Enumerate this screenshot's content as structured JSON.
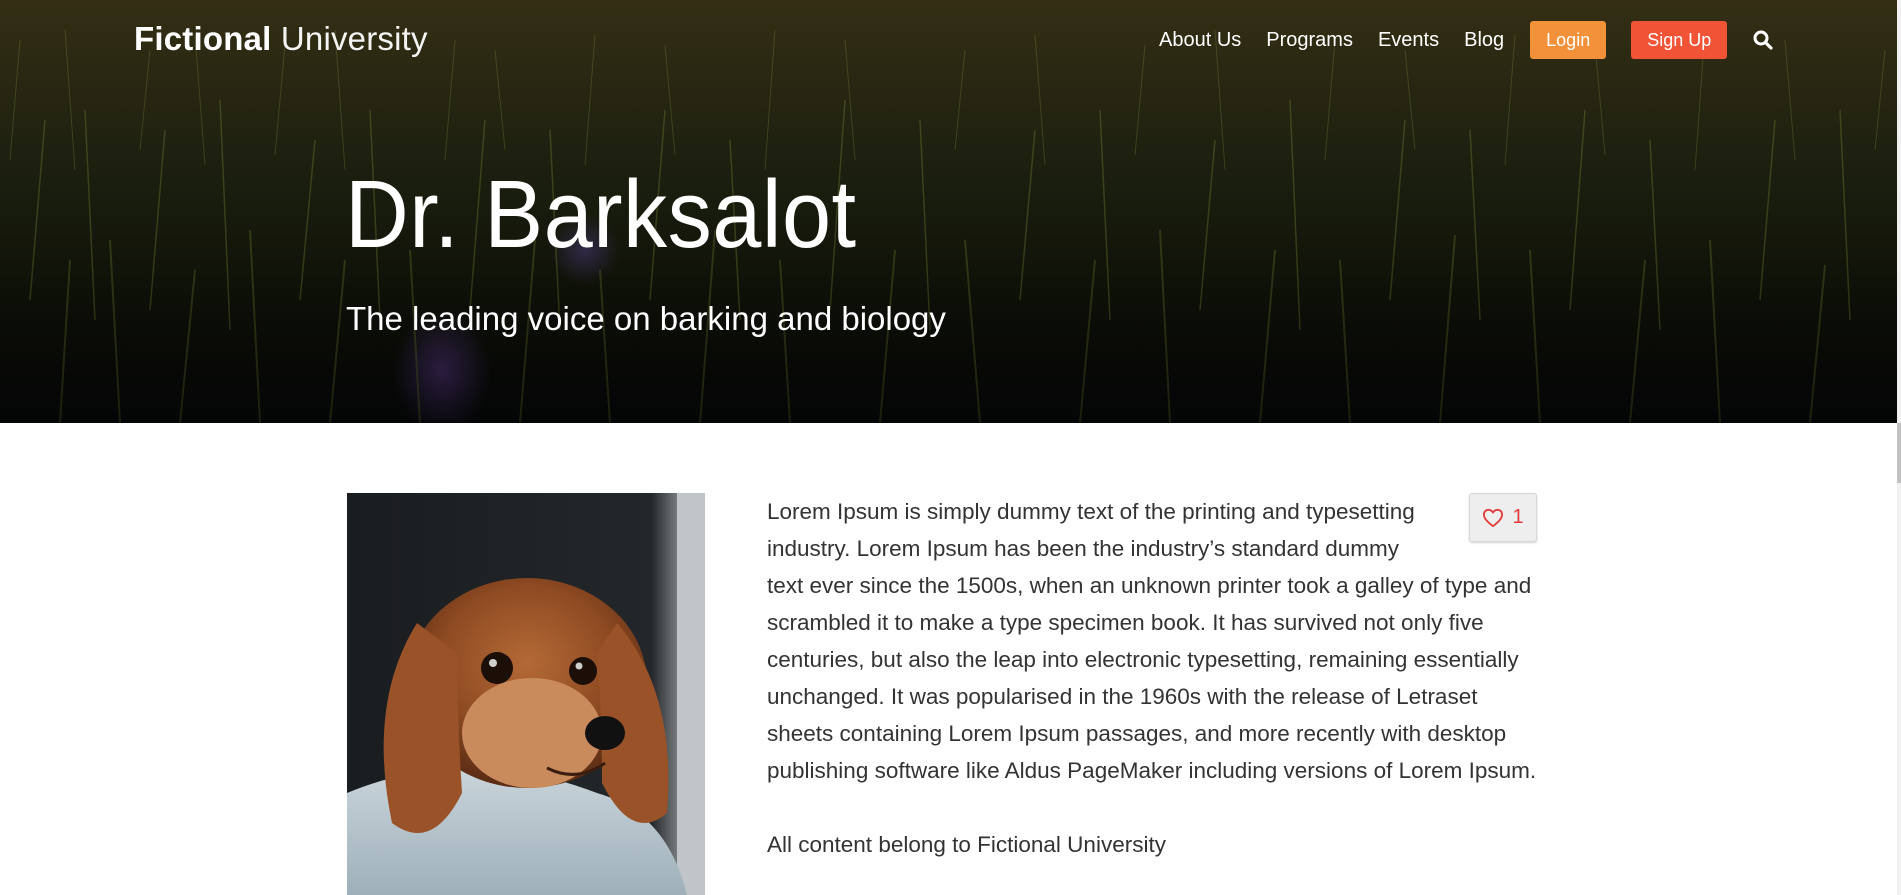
{
  "header": {
    "logo_bold": "Fictional",
    "logo_light": "University",
    "nav": [
      "About Us",
      "Programs",
      "Events",
      "Blog"
    ],
    "login_label": "Login",
    "signup_label": "Sign Up",
    "search_icon": "search-icon"
  },
  "hero": {
    "title": "Dr. Barksalot",
    "subtitle": "The leading voice on barking and biology"
  },
  "main": {
    "photo_icon": "dog-photo",
    "like": {
      "count": "1",
      "icon": "heart-icon",
      "color": "#e23b3b"
    },
    "paragraph_1": "Lorem Ipsum is simply dummy text of the printing and typesetting industry. Lorem Ipsum has been the industry’s standard dummy text ever since the 1500s, when an unknown printer took a galley of type and scrambled it to make a type specimen book. It has survived not only five centuries, but also the leap into electronic typesetting, remaining essentially unchanged. It was popularised in the 1960s with the release of Letraset sheets containing Lorem Ipsum passages, and more recently with desktop publishing software like Aldus PageMaker including versions of Lorem Ipsum.",
    "paragraph_2": "All content belong to Fictional University"
  },
  "colors": {
    "login_button": "#f2913a",
    "signup_button": "#f05335",
    "body_text": "#333333"
  }
}
